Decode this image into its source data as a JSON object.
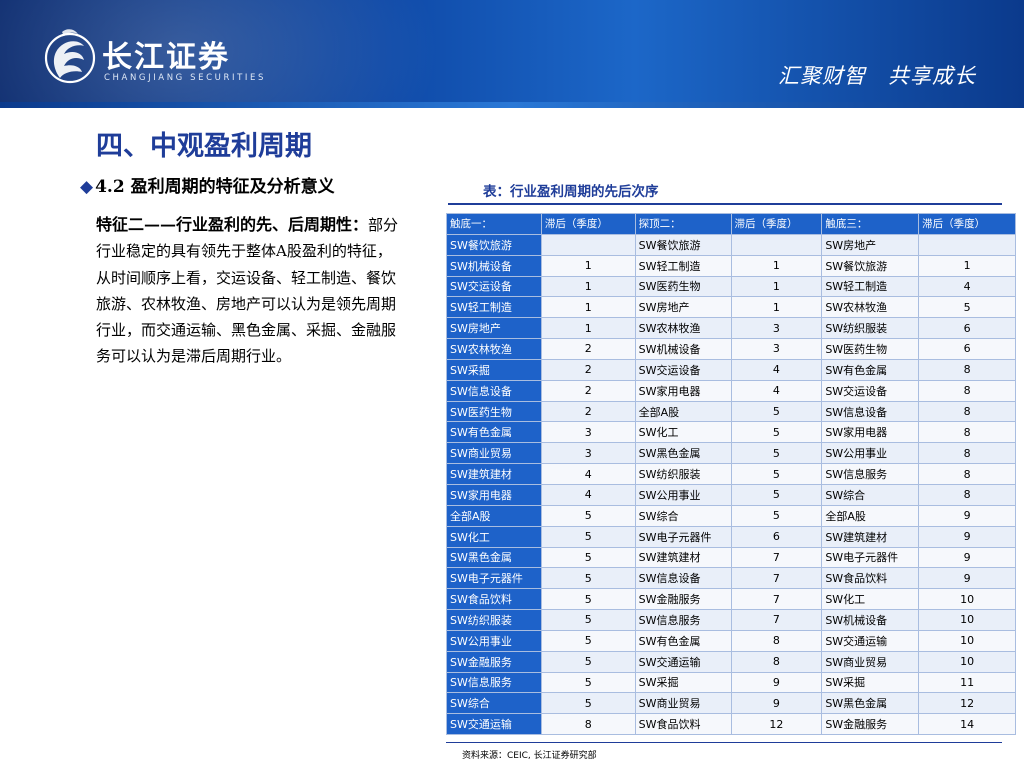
{
  "header": {
    "logo_cn": "长江证券",
    "logo_en": "CHANGJIANG SECURITIES",
    "slogan": "汇聚财智　共享成长"
  },
  "page_title": "四、中观盈利周期",
  "subtitle": {
    "bullet": "◆",
    "text": "4.2 盈利周期的特征及分析意义"
  },
  "body": {
    "emph": "特征二——行业盈利的先、后周期性：",
    "text": "部分行业稳定的具有领先于整体A股盈利的特征，从时间顺序上看，交运设备、轻工制造、餐饮旅游、农林牧渔、房地产可以认为是领先周期行业，而交通运输、黑色金属、采掘、金融服务可以认为是滞后周期行业。"
  },
  "table": {
    "caption": "表：行业盈利周期的先后次序",
    "headers": [
      "触底一：",
      "滞后（季度）",
      "探顶二：",
      "滞后（季度）",
      "触底三：",
      "滞后（季度）"
    ],
    "rows": [
      [
        "SW餐饮旅游",
        "",
        "SW餐饮旅游",
        "",
        "SW房地产",
        ""
      ],
      [
        "SW机械设备",
        "1",
        "SW轻工制造",
        "1",
        "SW餐饮旅游",
        "1"
      ],
      [
        "SW交运设备",
        "1",
        "SW医药生物",
        "1",
        "SW轻工制造",
        "4"
      ],
      [
        "SW轻工制造",
        "1",
        "SW房地产",
        "1",
        "SW农林牧渔",
        "5"
      ],
      [
        "SW房地产",
        "1",
        "SW农林牧渔",
        "3",
        "SW纺织服装",
        "6"
      ],
      [
        "SW农林牧渔",
        "2",
        "SW机械设备",
        "3",
        "SW医药生物",
        "6"
      ],
      [
        "SW采掘",
        "2",
        "SW交运设备",
        "4",
        "SW有色金属",
        "8"
      ],
      [
        "SW信息设备",
        "2",
        "SW家用电器",
        "4",
        "SW交运设备",
        "8"
      ],
      [
        "SW医药生物",
        "2",
        "全部A股",
        "5",
        "SW信息设备",
        "8"
      ],
      [
        "SW有色金属",
        "3",
        "SW化工",
        "5",
        "SW家用电器",
        "8"
      ],
      [
        "SW商业贸易",
        "3",
        "SW黑色金属",
        "5",
        "SW公用事业",
        "8"
      ],
      [
        "SW建筑建材",
        "4",
        "SW纺织服装",
        "5",
        "SW信息服务",
        "8"
      ],
      [
        "SW家用电器",
        "4",
        "SW公用事业",
        "5",
        "SW综合",
        "8"
      ],
      [
        "全部A股",
        "5",
        "SW综合",
        "5",
        "全部A股",
        "9"
      ],
      [
        "SW化工",
        "5",
        "SW电子元器件",
        "6",
        "SW建筑建材",
        "9"
      ],
      [
        "SW黑色金属",
        "5",
        "SW建筑建材",
        "7",
        "SW电子元器件",
        "9"
      ],
      [
        "SW电子元器件",
        "5",
        "SW信息设备",
        "7",
        "SW食品饮料",
        "9"
      ],
      [
        "SW食品饮料",
        "5",
        "SW金融服务",
        "7",
        "SW化工",
        "10"
      ],
      [
        "SW纺织服装",
        "5",
        "SW信息服务",
        "7",
        "SW机械设备",
        "10"
      ],
      [
        "SW公用事业",
        "5",
        "SW有色金属",
        "8",
        "SW交通运输",
        "10"
      ],
      [
        "SW金融服务",
        "5",
        "SW交通运输",
        "8",
        "SW商业贸易",
        "10"
      ],
      [
        "SW信息服务",
        "5",
        "SW采掘",
        "9",
        "SW采掘",
        "11"
      ],
      [
        "SW综合",
        "5",
        "SW商业贸易",
        "9",
        "SW黑色金属",
        "12"
      ],
      [
        "SW交通运输",
        "8",
        "SW食品饮料",
        "12",
        "SW金融服务",
        "14"
      ]
    ],
    "source": "资料来源：CEIC, 长江证券研究部"
  }
}
